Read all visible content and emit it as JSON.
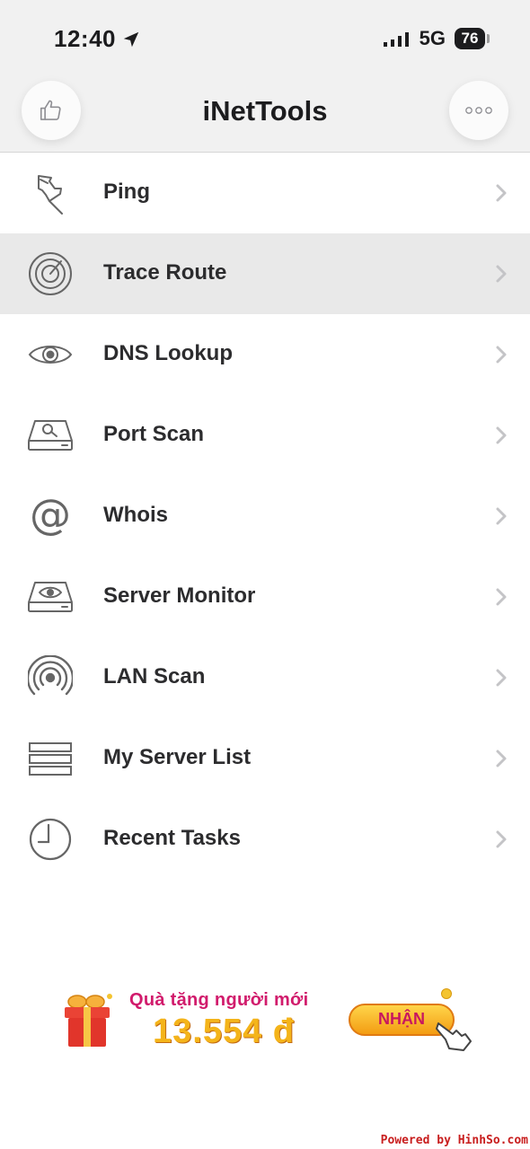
{
  "status_bar": {
    "time": "12:40",
    "network": "5G",
    "battery": "76",
    "location_icon": "location-arrow-icon",
    "signal_icon": "signal-bars-icon"
  },
  "nav": {
    "title": "iNetTools",
    "left_button_icon": "thumbs-up-icon",
    "right_button_icon": "more-dots-icon"
  },
  "menu": {
    "items": [
      {
        "label": "Ping",
        "icon": "pushpin-icon"
      },
      {
        "label": "Trace Route",
        "icon": "radar-icon",
        "highlighted": true
      },
      {
        "label": "DNS Lookup",
        "icon": "eye-icon"
      },
      {
        "label": "Port Scan",
        "icon": "drive-search-icon"
      },
      {
        "label": "Whois",
        "icon": "at-sign-icon"
      },
      {
        "label": "Server Monitor",
        "icon": "drive-eye-icon"
      },
      {
        "label": "LAN Scan",
        "icon": "wireless-icon"
      },
      {
        "label": "My Server List",
        "icon": "server-list-icon"
      },
      {
        "label": "Recent Tasks",
        "icon": "clock-icon"
      }
    ]
  },
  "banner": {
    "title": "Quà tặng người mới",
    "amount": "13.554 đ",
    "button": "NHẬN",
    "gift_icon": "gift-box-icon",
    "hand_icon": "pointing-hand-icon"
  },
  "watermark": "Powered by HinhSo.com",
  "colors": {
    "bar_background": "#f1f1f1",
    "highlight_row": "#e9e9e9",
    "icon_gray": "#666666",
    "banner_pink": "#d11b6c",
    "banner_gold": "#f4b41a"
  }
}
